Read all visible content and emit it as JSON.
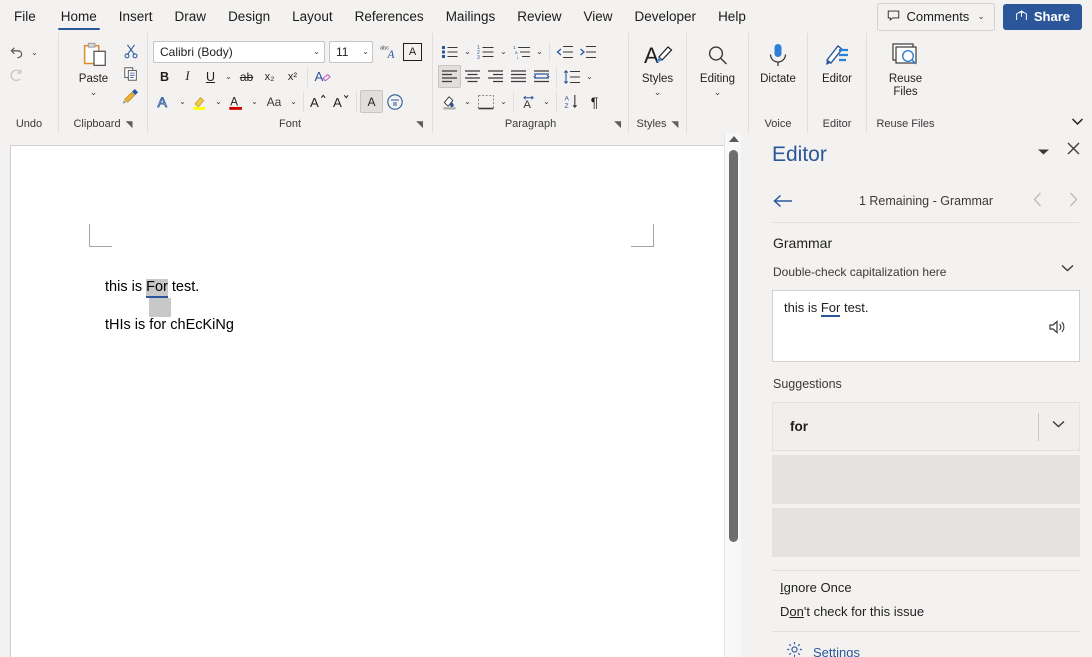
{
  "tabs": [
    {
      "label": "File",
      "active": false
    },
    {
      "label": "Home",
      "active": true
    },
    {
      "label": "Insert",
      "active": false
    },
    {
      "label": "Draw",
      "active": false
    },
    {
      "label": "Design",
      "active": false
    },
    {
      "label": "Layout",
      "active": false
    },
    {
      "label": "References",
      "active": false
    },
    {
      "label": "Mailings",
      "active": false
    },
    {
      "label": "Review",
      "active": false
    },
    {
      "label": "View",
      "active": false
    },
    {
      "label": "Developer",
      "active": false
    },
    {
      "label": "Help",
      "active": false
    }
  ],
  "titlebar": {
    "comments_label": "Comments",
    "comments_icon": "comment-icon",
    "comments_chevron": "⌄",
    "share_label": "Share",
    "share_icon": "share-icon"
  },
  "ribbon": {
    "collapse_icon": "chevron-down-icon",
    "groups": [
      {
        "name": "undo",
        "label": "Undo",
        "launcher": false
      },
      {
        "name": "clipboard",
        "label": "Clipboard",
        "launcher": true
      },
      {
        "name": "font",
        "label": "Font",
        "launcher": true
      },
      {
        "name": "paragraph",
        "label": "Paragraph",
        "launcher": true
      },
      {
        "name": "styles",
        "label": "Styles",
        "launcher": true
      },
      {
        "name": "editing",
        "label": "",
        "launcher": false
      },
      {
        "name": "voice",
        "label": "Voice",
        "launcher": false
      },
      {
        "name": "editor",
        "label": "Editor",
        "launcher": false
      },
      {
        "name": "reuse",
        "label": "Reuse Files",
        "launcher": false
      }
    ],
    "undo": {
      "undo_icon": "undo-icon",
      "redo_icon": "redo-icon",
      "chevron": "⌄"
    },
    "clipboard": {
      "paste_label": "Paste",
      "paste_icon": "paste-icon",
      "paste_chevron": "⌄",
      "cut_icon": "scissors-icon",
      "copy_icon": "copy-icon",
      "format_painter_icon": "format-painter-icon"
    },
    "font": {
      "font_name": "Calibri (Body)",
      "font_size": "11",
      "chevron": "⌄",
      "bold": "B",
      "italic": "I",
      "underline": "U",
      "strikethrough": "ab",
      "subscript": "x₂",
      "superscript": "x²",
      "clear_formatting_icon": "clear-formatting-icon",
      "text_effects_icon": "text-effects-icon",
      "change_case_label": "Aa",
      "grow_font": "A",
      "shrink_font": "A",
      "highlight_icon": "text-highlight-icon",
      "font_color_icon": "font-color-icon",
      "text_effects_a": "A",
      "phonetic_guide_icon": "phonetic-guide-icon",
      "char_shading": "A"
    },
    "paragraph": {
      "bullets_icon": "bullet-list-icon",
      "numbering_icon": "numbered-list-icon",
      "multilevel_icon": "multilevel-list-icon",
      "decrease_indent_icon": "decrease-indent-icon",
      "increase_indent_icon": "increase-indent-icon",
      "align_left_icon": "align-left-icon",
      "align_center_icon": "align-center-icon",
      "align_right_icon": "align-right-icon",
      "justify_icon": "justify-icon",
      "distributed_icon": "distributed-icon",
      "line_spacing_icon": "line-spacing-icon",
      "shading_icon": "shading-icon",
      "borders_icon": "borders-icon",
      "asian_layout_icon": "asian-layout-icon",
      "sort_icon": "sort-icon",
      "show_marks_icon": "paragraph-marks-icon",
      "chevron": "⌄"
    },
    "styles": {
      "label": "Styles",
      "icon": "styles-icon",
      "chevron": "⌄"
    },
    "editing": {
      "label": "Editing",
      "icon": "search-icon",
      "chevron": "⌄"
    },
    "voice": {
      "label": "Dictate",
      "icon": "microphone-icon"
    },
    "editor": {
      "label": "Editor",
      "icon": "editor-pen-icon"
    },
    "reuse": {
      "label_line1": "Reuse",
      "label_line2": "Files",
      "icon": "reuse-files-icon"
    }
  },
  "document": {
    "paragraph1_before": "this is ",
    "paragraph1_error": "For",
    "paragraph1_after": " test.",
    "paragraph2": "tHIs is for chEcKiNg"
  },
  "scrollbar": {
    "up_arrow_icon": "scroll-up-arrow-icon",
    "thumb": "scroll-thumb"
  },
  "editor_pane": {
    "title": "Editor",
    "collapse_icon": "chevron-down-icon",
    "close_icon": "close-icon",
    "back_icon": "back-arrow-icon",
    "status": "1 Remaining - Grammar",
    "prev_icon": "chevron-left-icon",
    "next_icon": "chevron-right-icon",
    "section_title": "Grammar",
    "issue_title": "Double-check capitalization here",
    "issue_chevron": "⌄",
    "context_before": "this is ",
    "context_error": "For",
    "context_after": " test.",
    "speaker_icon": "read-aloud-icon",
    "suggestions_label": "Suggestions",
    "suggestion_value": "for",
    "suggestion_chevron": "⌄",
    "ignore_once_prefix": "I",
    "ignore_once_rest": "gnore Once",
    "dont_check_prefix": "D",
    "dont_check_mid": "on",
    "dont_check_rest": "'t check for this issue",
    "settings_label": "Settings",
    "settings_icon": "gear-icon"
  },
  "colors": {
    "accent": "#2b579a",
    "ribbon_bg": "#f3f2f1",
    "selection": "#c8c8c8",
    "icon_blue": "#2b579a",
    "highlight_yellow": "#ffff00",
    "font_color_red": "#d00000"
  }
}
